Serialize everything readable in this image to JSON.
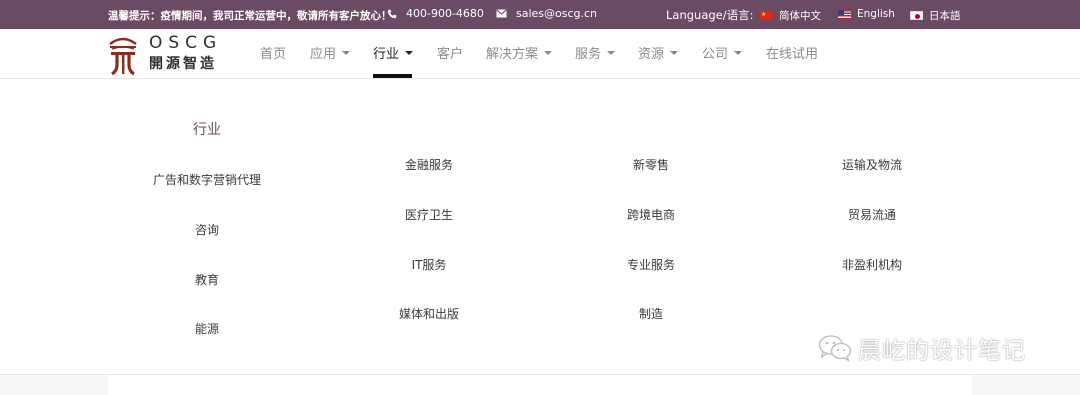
{
  "topbar": {
    "notice": "温馨提示：疫情期间，我司正常运营中，敬请所有客户放心！",
    "phone": "400-900-4680",
    "email": "sales@oscg.cn",
    "language_label": "Language/语言:",
    "languages": [
      {
        "label": "简体中文",
        "flag": "china-flag-icon"
      },
      {
        "label": "English",
        "flag": "us-flag-icon"
      },
      {
        "label": "日本語",
        "flag": "japan-flag-icon"
      }
    ]
  },
  "logo": {
    "en": "OSCG",
    "cn": "開源智造"
  },
  "nav": [
    {
      "label": "首页",
      "dropdown": false
    },
    {
      "label": "应用",
      "dropdown": true
    },
    {
      "label": "行业",
      "dropdown": true,
      "active": true
    },
    {
      "label": "客户",
      "dropdown": false
    },
    {
      "label": "解决方案",
      "dropdown": true
    },
    {
      "label": "服务",
      "dropdown": true
    },
    {
      "label": "资源",
      "dropdown": true
    },
    {
      "label": "公司",
      "dropdown": true
    },
    {
      "label": "在线试用",
      "dropdown": false
    }
  ],
  "menu": {
    "title": "行业",
    "column1": [
      "广告和数字营销代理",
      "咨询",
      "教育",
      "能源"
    ],
    "column2": [
      "金融服务",
      "医疗卫生",
      "IT服务",
      "媒体和出版"
    ],
    "column3": [
      "新零售",
      "跨境电商",
      "专业服务",
      "制造"
    ],
    "column4": [
      "运输及物流",
      "贸易流通",
      "非盈利机构"
    ]
  },
  "watermark": {
    "text": "晨屹的设计笔记"
  },
  "colors": {
    "brand": "#6b4a63",
    "logo_red": "#8b2a1f"
  }
}
